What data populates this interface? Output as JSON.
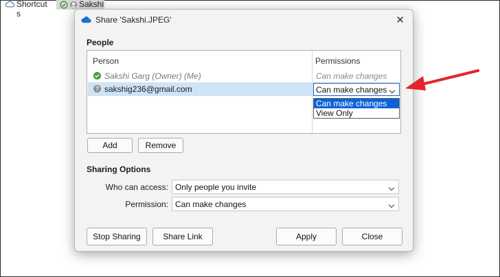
{
  "background": {
    "shortcuts_label_line1": "Shortcut",
    "shortcuts_label_line2": "s",
    "tab_label": "Sakshi"
  },
  "dialog": {
    "title": "Share 'Sakshi.JPEG'",
    "close_glyph": "✕",
    "people_heading": "People",
    "columns": {
      "person": "Person",
      "permissions": "Permissions"
    },
    "people": [
      {
        "name": "Sakshi Garg (Owner) (Me)",
        "permission": "Can make changes",
        "status": "ok"
      },
      {
        "name": "sakshig236@gmail.com",
        "permission": "Can make changes",
        "status": "unknown"
      }
    ],
    "permission_dropdown": {
      "selected": "Can make changes",
      "options": [
        "Can make changes",
        "View Only"
      ]
    },
    "add_label": "Add",
    "remove_label": "Remove",
    "sharing_heading": "Sharing Options",
    "who_can_access_label": "Who can access:",
    "who_can_access_value": "Only people you invite",
    "permission_label": "Permission:",
    "permission_value": "Can make changes",
    "stop_sharing_label": "Stop Sharing",
    "share_link_label": "Share Link",
    "apply_label": "Apply",
    "close_label": "Close"
  },
  "icons": {
    "cloud": "cloud-icon",
    "check": "check-circle-icon",
    "question": "question-circle-icon",
    "chevron": "chevron-down-icon",
    "arrow": "red-arrow-annotation"
  },
  "colors": {
    "accent": "#0a64d8",
    "row_highlight": "#cfe3f7",
    "annotation": "#e5242b"
  }
}
